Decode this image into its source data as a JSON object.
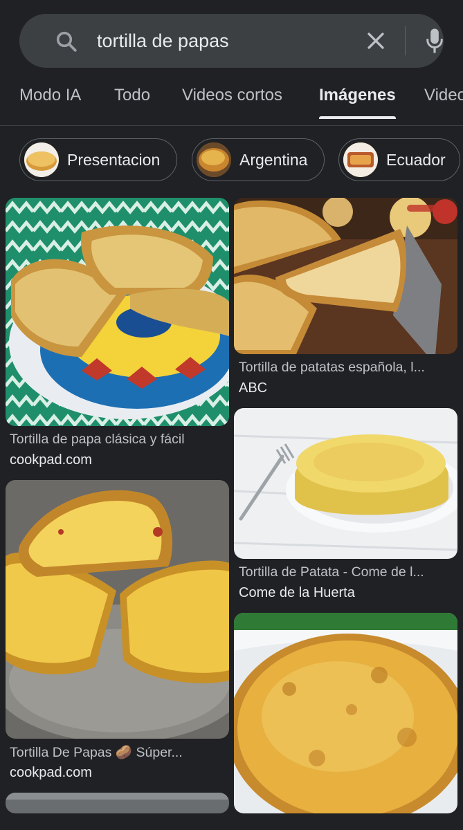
{
  "search": {
    "query": "tortilla de papas"
  },
  "tabs": [
    {
      "label": "Modo IA"
    },
    {
      "label": "Todo"
    },
    {
      "label": "Videos cortos"
    },
    {
      "label": "Imágenes",
      "active": true
    },
    {
      "label": "Video"
    }
  ],
  "chips": [
    {
      "label": "Presentacion"
    },
    {
      "label": "Argentina"
    },
    {
      "label": "Ecuador"
    }
  ],
  "results": [
    {
      "title": "Tortilla de papa clásica y fácil",
      "source": "cookpad.com"
    },
    {
      "title": "Tortilla de patatas española, l...",
      "source": "ABC"
    },
    {
      "title": "Tortilla de Patata - Come de l...",
      "source": "Come de la Huerta"
    },
    {
      "title": "Tortilla De Papas 🥔 Súper...",
      "source": "cookpad.com"
    },
    {
      "title": "",
      "source": ""
    }
  ],
  "colors": {
    "background": "#202124",
    "searchbar": "#3c4043",
    "text": "#e8eaed",
    "muted": "#bdc1c6"
  }
}
